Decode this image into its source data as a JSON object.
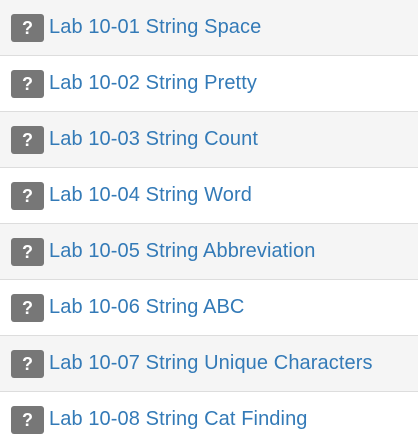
{
  "colors": {
    "link": "#337ab7",
    "badge_bg": "#777777",
    "badge_fg": "#ffffff",
    "row_shaded": "#f5f5f5",
    "row_plain": "#ffffff",
    "divider": "#dddddd"
  },
  "problems": [
    {
      "status_icon": "question-mark-icon",
      "status_glyph": "?",
      "title": "Lab 10-01 String Space"
    },
    {
      "status_icon": "question-mark-icon",
      "status_glyph": "?",
      "title": "Lab 10-02 String Pretty"
    },
    {
      "status_icon": "question-mark-icon",
      "status_glyph": "?",
      "title": "Lab 10-03 String Count"
    },
    {
      "status_icon": "question-mark-icon",
      "status_glyph": "?",
      "title": "Lab 10-04 String Word"
    },
    {
      "status_icon": "question-mark-icon",
      "status_glyph": "?",
      "title": "Lab 10-05 String Abbreviation"
    },
    {
      "status_icon": "question-mark-icon",
      "status_glyph": "?",
      "title": "Lab 10-06 String ABC"
    },
    {
      "status_icon": "question-mark-icon",
      "status_glyph": "?",
      "title": "Lab 10-07 String Unique Characters"
    },
    {
      "status_icon": "question-mark-icon",
      "status_glyph": "?",
      "title": "Lab 10-08 String Cat Finding"
    }
  ]
}
